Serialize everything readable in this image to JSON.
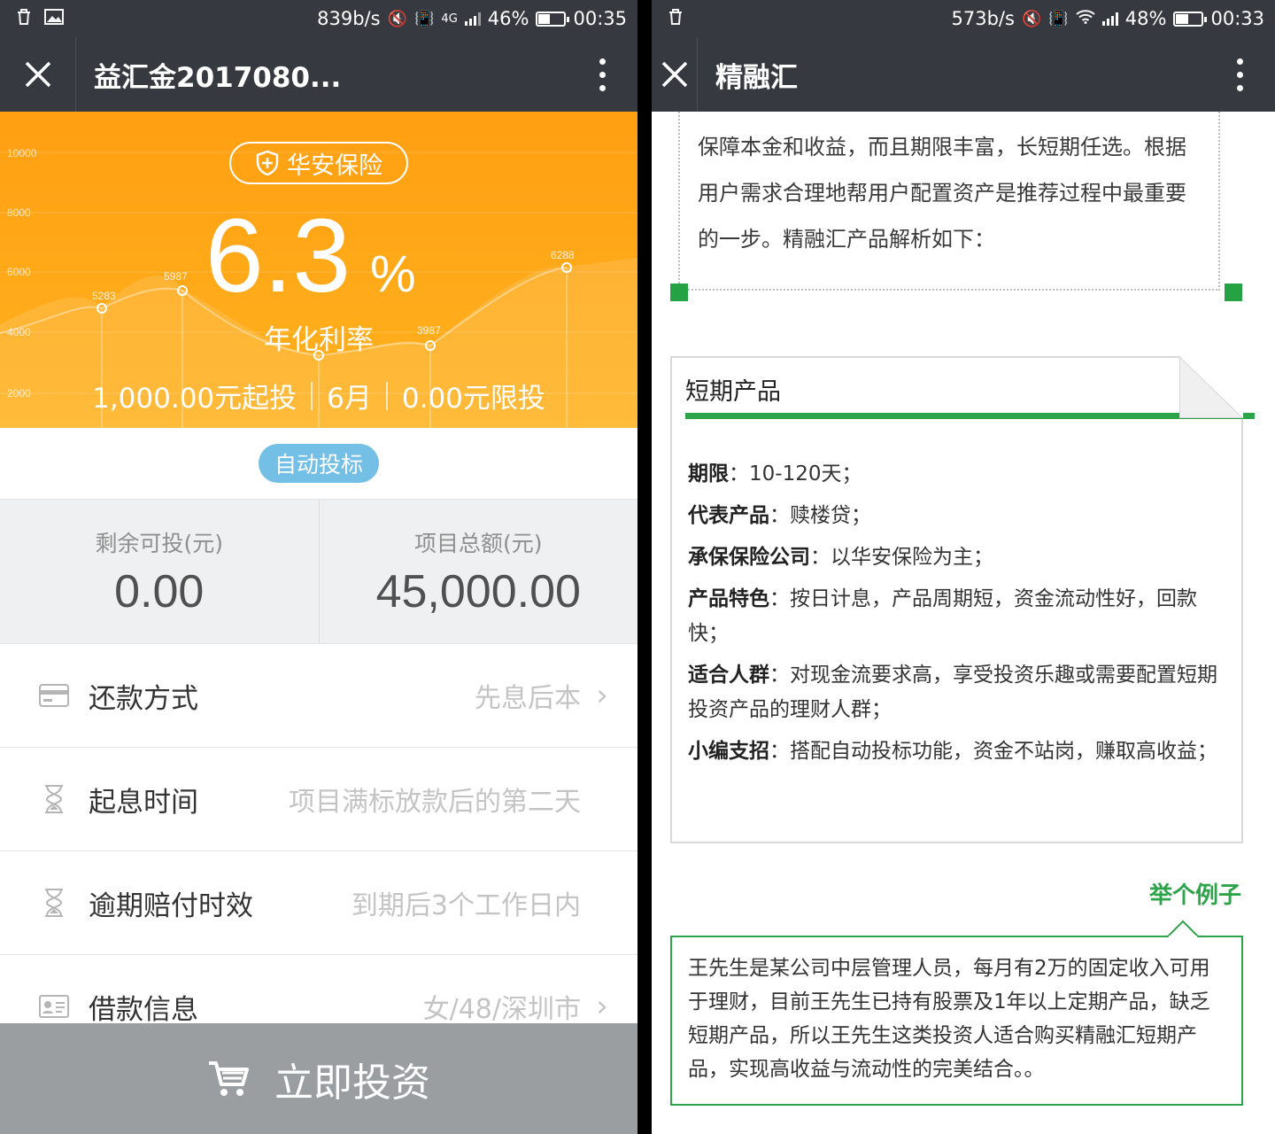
{
  "left": {
    "status": {
      "speed": "839b/s",
      "network": "4G",
      "battery": "46%",
      "battery_level": 0.46,
      "time": "00:35"
    },
    "title": "益汇金2017080...",
    "insurer_badge": "华安保险",
    "rate": {
      "value": "6.3",
      "unit": "%",
      "label": "年化利率"
    },
    "chart_bg": {
      "y_ticks": [
        "10000",
        "8000",
        "6000",
        "4000",
        "2000"
      ],
      "point_labels": [
        "5283",
        "5987",
        "3987",
        "6288"
      ]
    },
    "hero_info": {
      "min_invest": "1,000.00元起投",
      "term": "6月",
      "limit": "0.00元限投"
    },
    "auto_bid": "自动投标",
    "amounts": {
      "remaining_label": "剩余可投(元)",
      "remaining_value": "0.00",
      "total_label": "项目总额(元)",
      "total_value": "45,000.00"
    },
    "rows": [
      {
        "label": "还款方式",
        "value": "先息后本",
        "icon": "card-icon",
        "chevron": true
      },
      {
        "label": "起息时间",
        "value": "项目满标放款后的第二天",
        "icon": "hourglass-icon",
        "chevron": false
      },
      {
        "label": "逾期赔付时效",
        "value": "到期后3个工作日内",
        "icon": "hourglass-icon",
        "chevron": false
      },
      {
        "label": "借款信息",
        "value": "女/48/深圳市",
        "icon": "id-card-icon",
        "chevron": true
      }
    ],
    "invest_button": "立即投资"
  },
  "right": {
    "status": {
      "speed": "573b/s",
      "battery": "48%",
      "battery_level": 0.48,
      "time": "00:33"
    },
    "title": "精融汇",
    "intro_lines": [
      "保障本金和收益，而且期限丰富，长短期任选。根据",
      "用户需求合理地帮用户配置资产是推荐过程中最重要",
      "的一步。精融汇产品解析如下："
    ],
    "card": {
      "heading": "短期产品",
      "items": [
        {
          "key": "期限",
          "text": "10-120天；"
        },
        {
          "key": "代表产品",
          "text": "赎楼贷；"
        },
        {
          "key": "承保保险公司",
          "text": "以华安保险为主；"
        },
        {
          "key": "产品特色",
          "text": "按日计息，产品周期短，资金流动性好，回款快；"
        },
        {
          "key": "适合人群",
          "text": "对现金流要求高，享受投资乐趣或需要配置短期投资产品的理财人群；"
        },
        {
          "key": "小编支招",
          "text": "搭配自动投标功能，资金不站岗，赚取高收益；"
        }
      ]
    },
    "example_label": "举个例子",
    "example_text": "王先生是某公司中层管理人员，每月有2万的固定收入可用于理财，目前王先生已持有股票及1年以上定期产品，缺乏短期产品，所以王先生这类投资人适合购买精融汇短期产品，实现高收益与流动性的完美结合。。"
  },
  "colors": {
    "orange": "#ffa617",
    "green": "#2ea44a",
    "bar": "#36393f",
    "pill_blue": "#74bfe6"
  }
}
